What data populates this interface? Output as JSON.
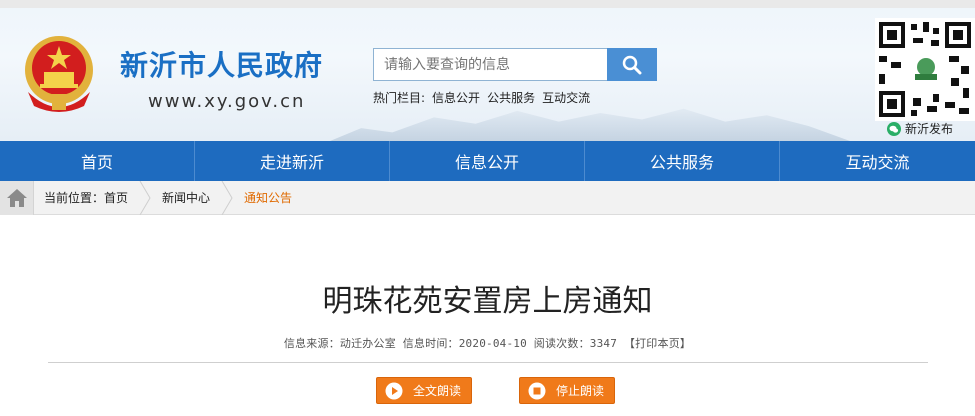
{
  "header": {
    "site_title": "新沂市人民政府",
    "site_url": "www.xy.gov.cn",
    "search_placeholder": "请输入要查询的信息",
    "hot_label": "热门栏目:",
    "hot_links": [
      "信息公开",
      "公共服务",
      "互动交流"
    ],
    "qr_label": "新沂发布",
    "qr_brand": "新沂发布",
    "accent_color": "#1e6bbf",
    "emblem_color": "#d21e1e"
  },
  "nav": {
    "items": [
      "首页",
      "走进新沂",
      "信息公开",
      "公共服务",
      "互动交流"
    ]
  },
  "breadcrumb": {
    "prefix": "当前位置：首页",
    "items": [
      "新闻中心",
      "通知公告"
    ],
    "current_color": "#e06a00"
  },
  "article": {
    "title": "明珠花苑安置房上房通知",
    "meta": "信息来源：动迁办公室 信息时间：2020-04-10 阅读次数：3347 【打印本页】"
  },
  "buttons": {
    "read_all": "全文朗读",
    "stop_read": "停止朗读",
    "button_color": "#f07a1a"
  },
  "icons": {
    "home": "home-icon",
    "search": "search-icon",
    "play": "play-icon",
    "stop": "stop-icon",
    "wechat": "wechat-icon",
    "emblem": "national-emblem-icon"
  }
}
